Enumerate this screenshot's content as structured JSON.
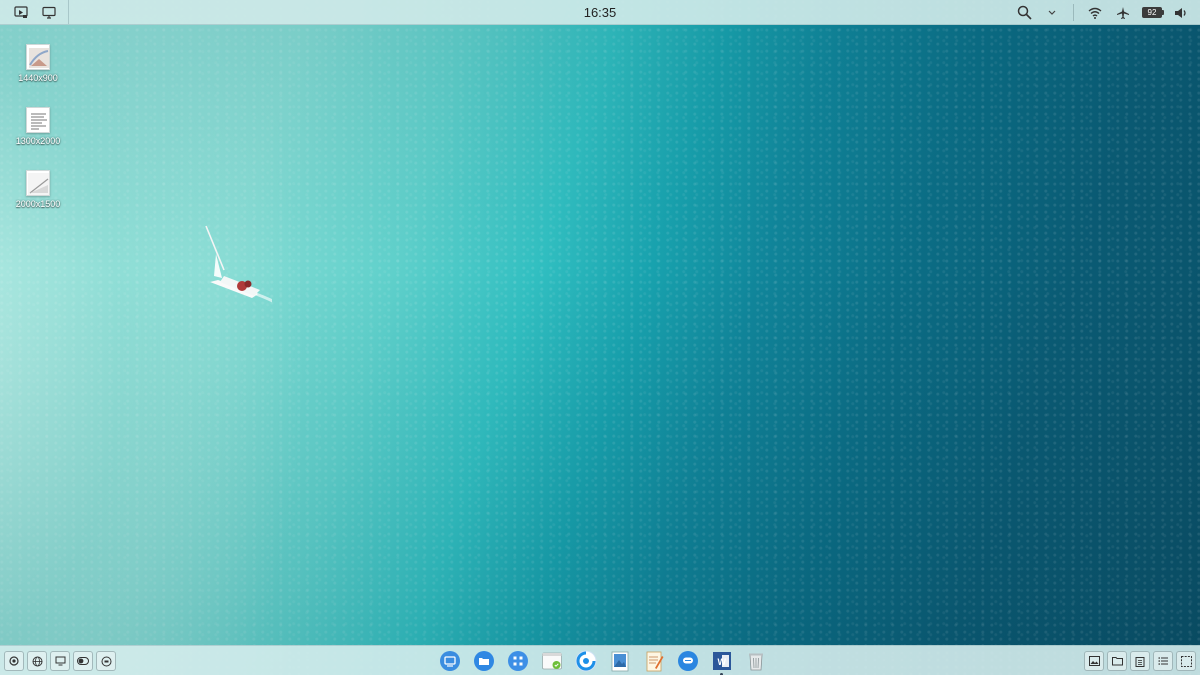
{
  "top_bar": {
    "clock": "16:35",
    "battery_level": "92",
    "left_icons": [
      "screenshot-icon",
      "display-icon"
    ],
    "right_icons": [
      "search-icon",
      "chevron-down-icon",
      "wifi-icon",
      "airplane-icon",
      "battery-icon",
      "volume-icon"
    ]
  },
  "desktop": {
    "icons": [
      {
        "label": "1440x900",
        "type": "image"
      },
      {
        "label": "1300x2000",
        "type": "document"
      },
      {
        "label": "2000x1500",
        "type": "image"
      }
    ]
  },
  "taskbar": {
    "left_buttons": [
      "power-icon",
      "globe-icon",
      "monitor-icon",
      "toggle-icon",
      "record-icon"
    ],
    "dock": [
      "launcher-icon",
      "file-manager-icon",
      "app-grid-icon",
      "terminal-icon",
      "browser-icon",
      "image-viewer-icon",
      "text-editor-icon",
      "chat-icon",
      "word-icon",
      "trash-icon"
    ],
    "right_buttons": [
      "gallery-icon",
      "folder-icon",
      "clipboard-icon",
      "list-icon",
      "show-desktop-icon"
    ]
  },
  "colors": {
    "shallow_water": "#9be2dc",
    "deep_water": "#0a4f66",
    "bar_background": "#cee9e8"
  }
}
